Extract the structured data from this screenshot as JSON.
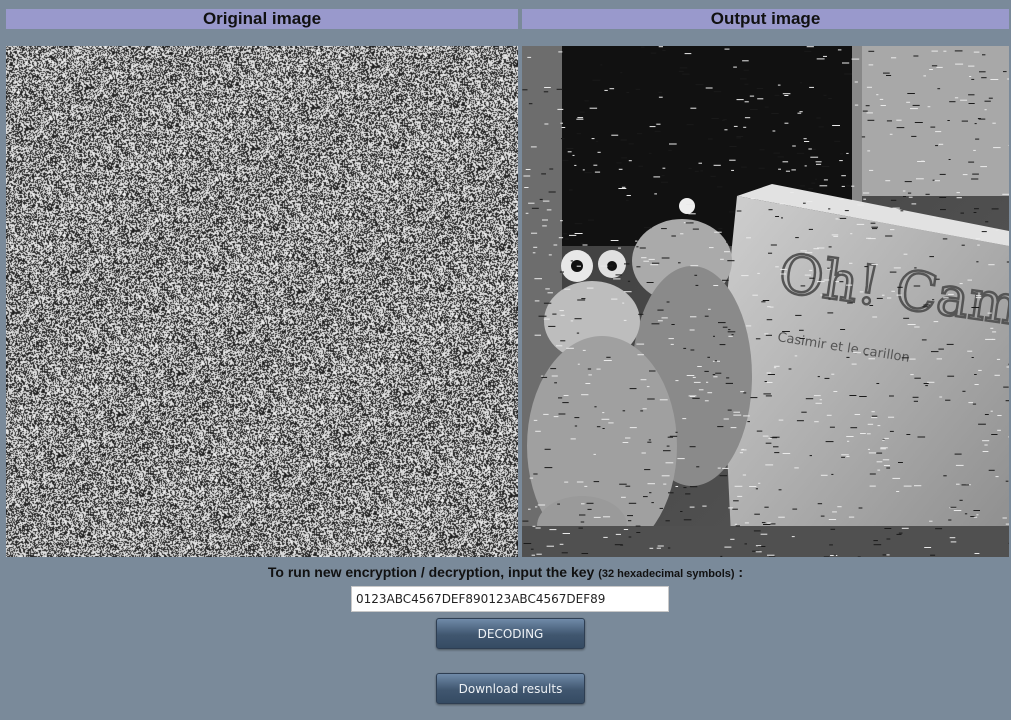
{
  "panels": {
    "original": {
      "title": "Original image"
    },
    "output": {
      "title": "Output image"
    }
  },
  "instruction": {
    "main": "To run new encryption / decryption, input the key",
    "hint": "(32 hexadecimal symbols)",
    "suffix": " :"
  },
  "key_field": {
    "value": "0123ABC4567DEF890123ABC4567DEF89"
  },
  "buttons": {
    "decode": "DECODING",
    "download": "Download results"
  },
  "output_image_text": {
    "book_title": "Oh! Cam",
    "book_subtitle": "Casimir et le carillon"
  },
  "colors": {
    "background": "#7a8a9a",
    "header": "#9999cc",
    "button": "#40566f"
  }
}
